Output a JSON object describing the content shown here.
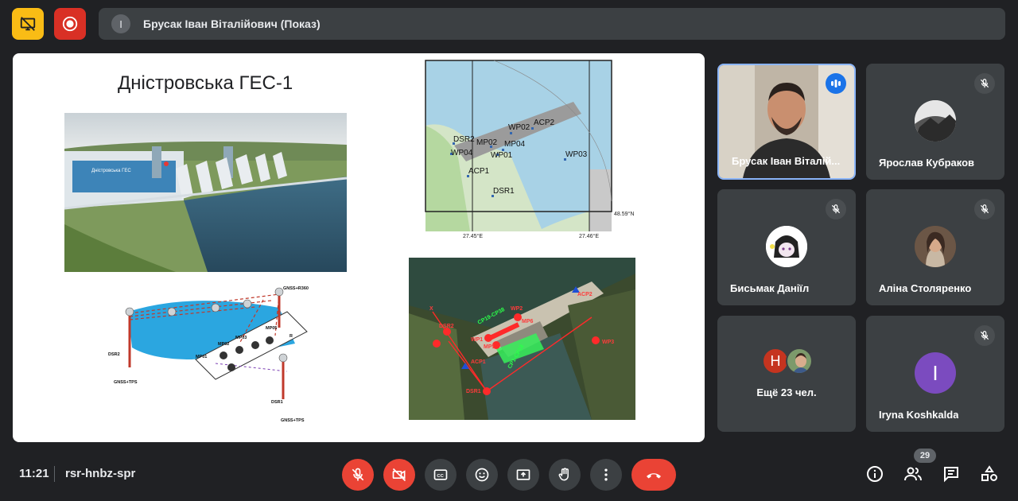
{
  "top": {
    "presenter_initial": "I",
    "presenter_label": "Брусак Іван Віталійович (Показ)"
  },
  "slide": {
    "title": "Дністровська ГЕС-1",
    "photo_sign": "Дністровська ГЕС",
    "sketch_labels": {
      "gnss_r360": "GNSS+R360",
      "dsr2": "DSR2",
      "gnss_tps_left": "GNSS+TPS",
      "mp01": "MP01",
      "mp02": "MP02",
      "mp03": "MP03",
      "mp05": "MP05",
      "r": "R",
      "dsr1": "DSR1",
      "gnss_tps_bottom": "GNSS+TPS"
    },
    "map_labels": {
      "dsr2": "DSR2",
      "wp04": "WP04",
      "mp02": "MP02",
      "mp04": "MP04",
      "wp01": "WP01",
      "wp02": "WP02",
      "acp2": "ACP2",
      "acp1": "ACP1",
      "dsr1": "DSR1",
      "wp03": "WP03",
      "lat": "48.59°N",
      "lon1": "27.45°E",
      "lon2": "27.46°E"
    },
    "sat_labels": {
      "acp2": "ACP2",
      "wp2": "WP2",
      "mp6": "MP6",
      "cp19_cp38": "CP19-CP38",
      "dsr2": "DSR2",
      "wp1": "WP1",
      "mp1": "MP1",
      "cp1_cp18": "CP1-CP18",
      "acp1": "ACP1",
      "dsr1": "DSR1",
      "wp3": "WP3",
      "x": "X"
    }
  },
  "tiles": [
    {
      "name": "Брусак Іван Віталій...",
      "speaking": true
    },
    {
      "name": "Ярослав Кубраков",
      "muted": true
    },
    {
      "name": "Бисьмак Даніїл",
      "muted": true
    },
    {
      "name": "Аліна Столяренко",
      "muted": true
    },
    {
      "name": "Ещё 23 чел.",
      "more_initial": "Н"
    },
    {
      "name": "Iryna Koshkalda",
      "muted": true,
      "initial": "I"
    }
  ],
  "bottom": {
    "time": "11:21",
    "meeting_code": "rsr-hnbz-spr",
    "participants_count": "29"
  },
  "colors": {
    "background": "#202124",
    "tile": "#3c4043",
    "danger": "#ea4335",
    "accent_blue": "#8ab4f8",
    "yellow": "#f9bc15",
    "purple_avatar": "#7b4bbf"
  }
}
